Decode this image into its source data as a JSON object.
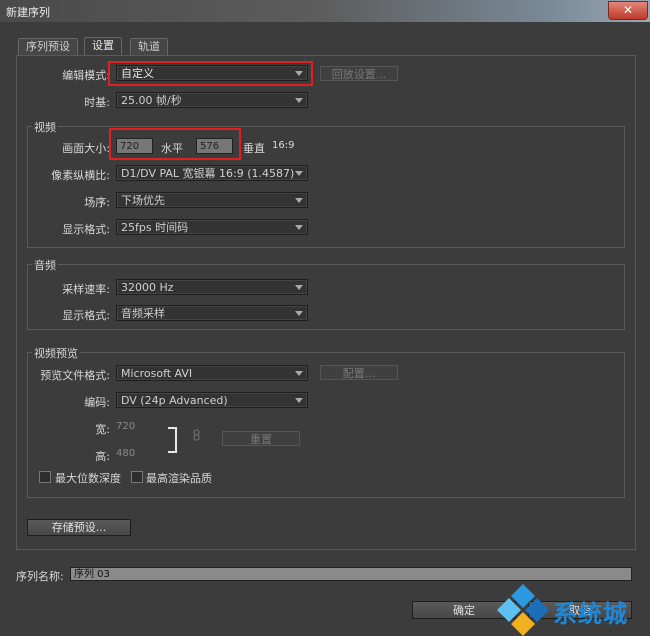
{
  "window": {
    "title": "新建序列",
    "close_icon": "close-icon"
  },
  "tabs": [
    {
      "label": "序列预设"
    },
    {
      "label": "设置"
    },
    {
      "label": "轨道"
    }
  ],
  "settings": {
    "edit_mode": {
      "label": "编辑模式:",
      "value": "自定义"
    },
    "playback_settings_button": "回放设置...",
    "timebase": {
      "label": "时基:",
      "value": "25.00 帧/秒"
    }
  },
  "video": {
    "group_label": "视频",
    "frame_size": {
      "label": "画面大小:",
      "width": "720",
      "h_label": "水平",
      "height": "576",
      "v_label": "垂直",
      "aspect": "16:9"
    },
    "pixel_aspect": {
      "label": "像素纵横比:",
      "value": "D1/DV PAL 宽银幕 16:9 (1.4587)"
    },
    "fields": {
      "label": "场序:",
      "value": "下场优先"
    },
    "display_format": {
      "label": "显示格式:",
      "value": "25fps 时间码"
    }
  },
  "audio": {
    "group_label": "音频",
    "sample_rate": {
      "label": "采样速率:",
      "value": "32000 Hz"
    },
    "display_format": {
      "label": "显示格式:",
      "value": "音频采样"
    }
  },
  "video_preview": {
    "group_label": "视频预览",
    "file_format": {
      "label": "预览文件格式:",
      "value": "Microsoft AVI"
    },
    "configure_button": "配置...",
    "codec": {
      "label": "编码:",
      "value": "DV (24p Advanced)"
    },
    "width": {
      "label": "宽:",
      "value": "720"
    },
    "height": {
      "label": "高:",
      "value": "480"
    },
    "reset_button": "重置",
    "max_bit_depth": "最大位数深度",
    "max_render_quality": "最高渲染品质"
  },
  "save_preset_button": "存储预设...",
  "sequence_name": {
    "label": "序列名称:",
    "value": "序列 03"
  },
  "ok_button": "确定",
  "cancel_button": "取消",
  "watermark": {
    "text": "系统城"
  }
}
